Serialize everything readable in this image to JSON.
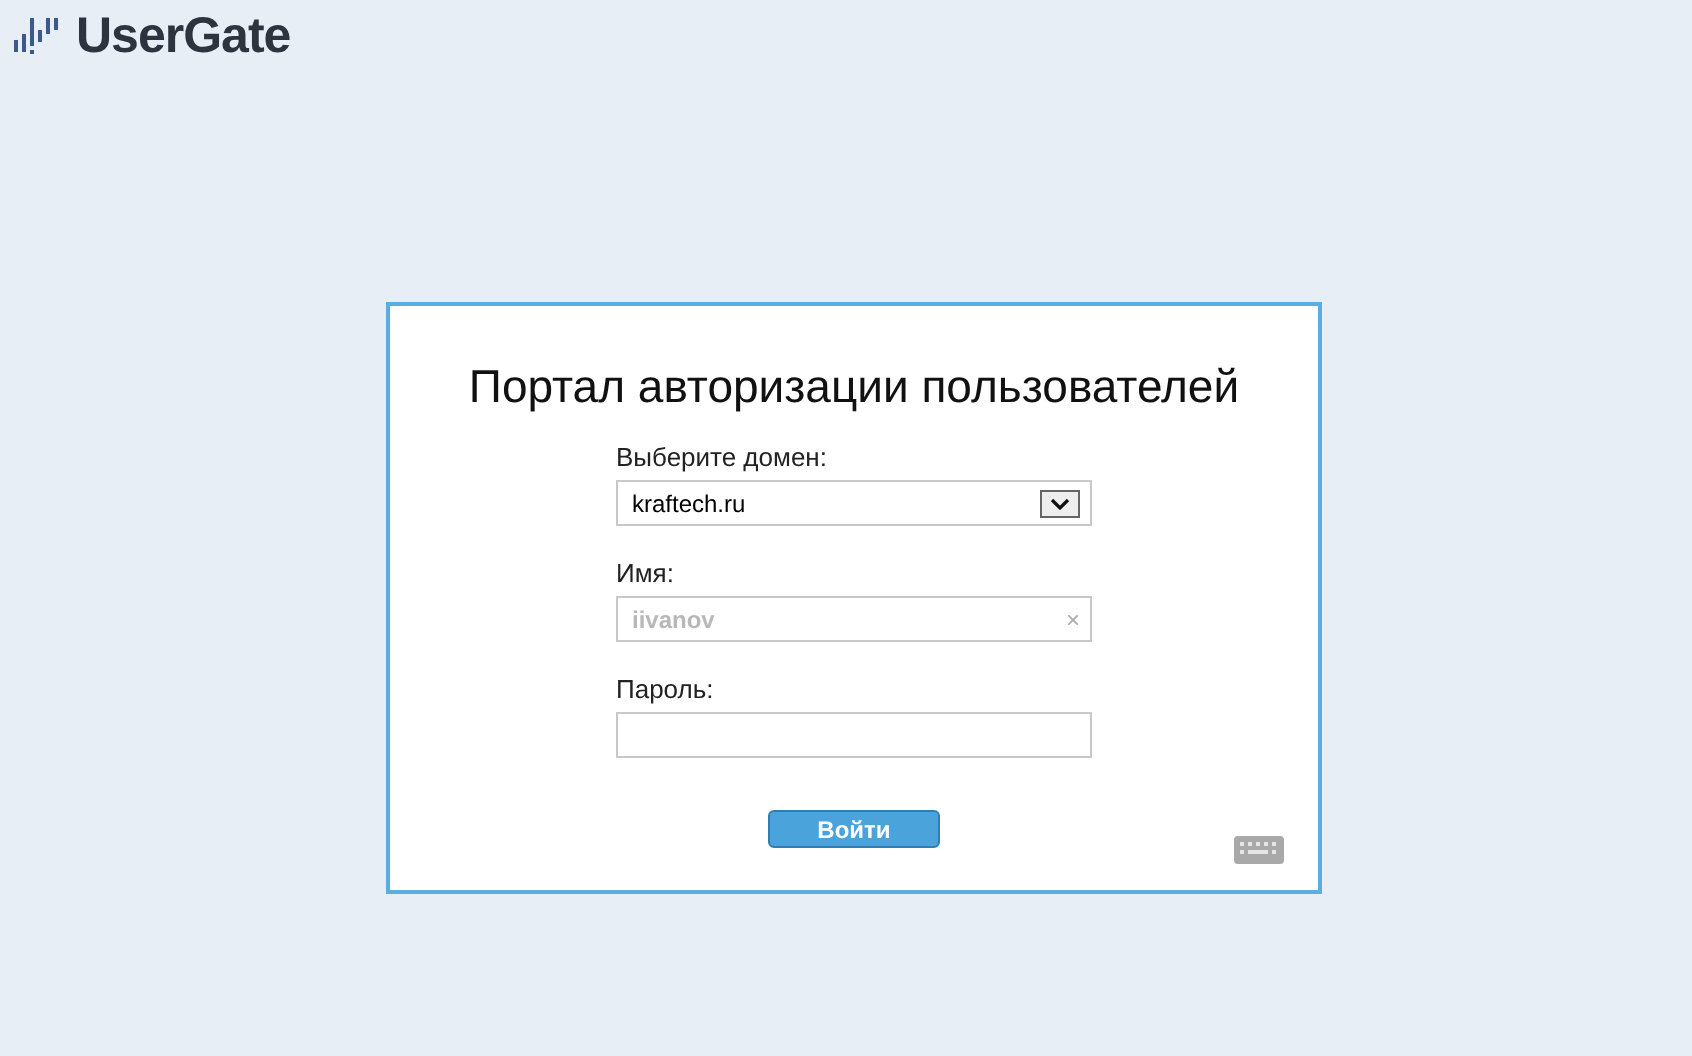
{
  "logo": {
    "text": "UserGate"
  },
  "form": {
    "title": "Портал авторизации пользователей",
    "domain": {
      "label": "Выберите домен:",
      "value": "kraftech.ru"
    },
    "name": {
      "label": "Имя:",
      "placeholder": "iivanov",
      "clear": "×"
    },
    "password": {
      "label": "Пароль:"
    },
    "submit": "Войти"
  }
}
